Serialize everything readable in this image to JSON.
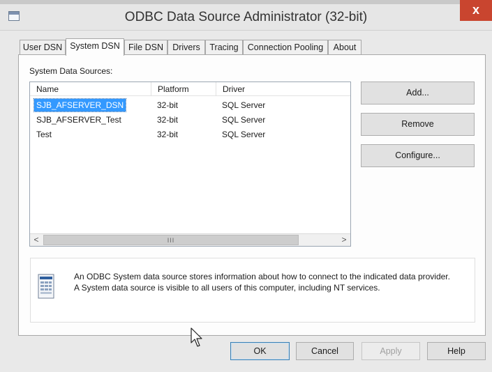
{
  "window": {
    "title": "ODBC Data Source Administrator (32-bit)",
    "close_glyph": "x"
  },
  "tabs": [
    {
      "label": "User DSN",
      "active": false
    },
    {
      "label": "System DSN",
      "active": true
    },
    {
      "label": "File DSN",
      "active": false
    },
    {
      "label": "Drivers",
      "active": false
    },
    {
      "label": "Tracing",
      "active": false
    },
    {
      "label": "Connection Pooling",
      "active": false
    },
    {
      "label": "About",
      "active": false
    }
  ],
  "section_label": "System Data Sources:",
  "table": {
    "columns": [
      "Name",
      "Platform",
      "Driver"
    ],
    "rows": [
      {
        "name": "SJB_AFSERVER_DSN",
        "platform": "32-bit",
        "driver": "SQL Server",
        "selected": true
      },
      {
        "name": "SJB_AFSERVER_Test",
        "platform": "32-bit",
        "driver": "SQL Server",
        "selected": false
      },
      {
        "name": "Test",
        "platform": "32-bit",
        "driver": "SQL Server",
        "selected": false
      }
    ]
  },
  "scrollbar": {
    "left_arrow": "<",
    "right_arrow": ">",
    "grip": "III"
  },
  "side_buttons": {
    "add": "Add...",
    "remove": "Remove",
    "configure": "Configure..."
  },
  "info": {
    "line1": "An ODBC System data source stores information about how to connect to the indicated data provider.",
    "line2": "A System data source is visible to all users of this computer, including NT services."
  },
  "bottom_buttons": {
    "ok": "OK",
    "cancel": "Cancel",
    "apply": "Apply",
    "help": "Help"
  },
  "colors": {
    "selection": "#3399ff",
    "close": "#c9452f"
  }
}
